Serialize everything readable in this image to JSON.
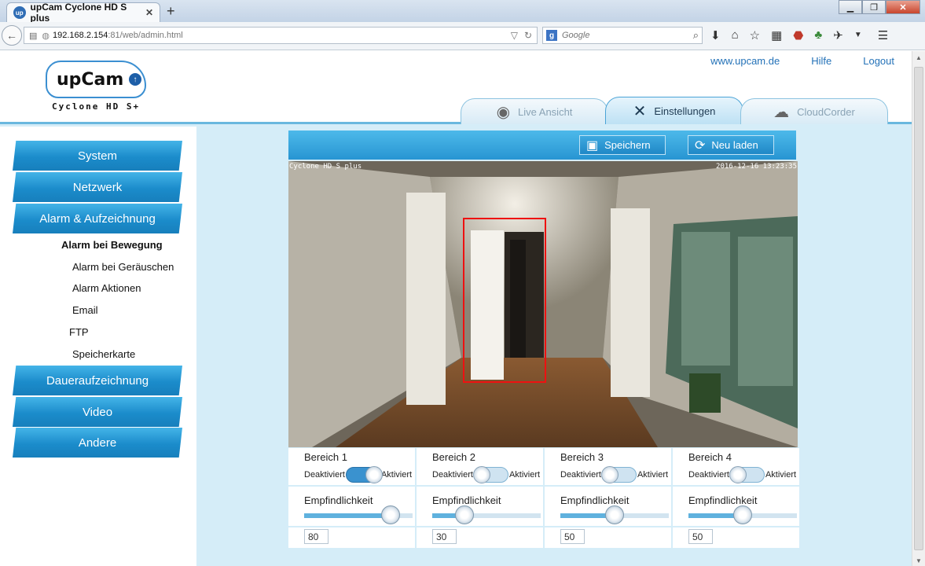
{
  "browser": {
    "tab_title": "upCam Cyclone HD S plus",
    "favicon_text": "up",
    "url_host": "192.168.2.154",
    "url_path": ":81/web/admin.html",
    "search_placeholder": "Google"
  },
  "header": {
    "brand": "upCam",
    "subtitle": "Cyclone HD S+",
    "links": {
      "site": "www.upcam.de",
      "help": "Hilfe",
      "logout": "Logout"
    },
    "tabs": {
      "live": "Live Ansicht",
      "settings": "Einstellungen",
      "cloud": "CloudCorder"
    }
  },
  "sidebar": {
    "system": "System",
    "network": "Netzwerk",
    "alarm": "Alarm & Aufzeichnung",
    "sub": {
      "motion": "Alarm bei Bewegung",
      "noise": "Alarm bei Geräuschen",
      "actions": "Alarm Aktionen",
      "email": "Email",
      "ftp": "FTP",
      "sdcard": "Speicherkarte"
    },
    "continuous": "Daueraufzeichnung",
    "video": "Video",
    "other": "Andere"
  },
  "toolbar": {
    "save": "Speichern",
    "reload": "Neu laden"
  },
  "camera": {
    "overlay_left": "Cyclone HD S plus",
    "overlay_right": "2016-12-16 13:23:35"
  },
  "areas": [
    {
      "name": "Bereich 1",
      "off": "Deaktiviert",
      "on": "Aktiviert",
      "active": true,
      "sens_label": "Empfindlichkeit",
      "value": "80"
    },
    {
      "name": "Bereich 2",
      "off": "Deaktiviert",
      "on": "Aktiviert",
      "active": false,
      "sens_label": "Empfindlichkeit",
      "value": "30"
    },
    {
      "name": "Bereich 3",
      "off": "Deaktiviert",
      "on": "Aktiviert",
      "active": false,
      "sens_label": "Empfindlichkeit",
      "value": "50"
    },
    {
      "name": "Bereich 4",
      "off": "Deaktiviert",
      "on": "Aktiviert",
      "active": false,
      "sens_label": "Empfindlichkeit",
      "value": "50"
    }
  ],
  "colors": {
    "accent": "#2795d2",
    "motion_box": "#ee1111",
    "page_bg": "#d5edf8"
  }
}
